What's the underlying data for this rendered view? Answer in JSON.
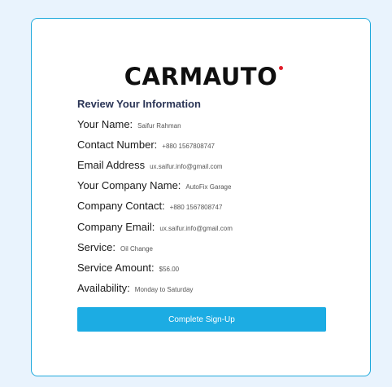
{
  "brand": {
    "name": "CARMAUTO",
    "accent_dot_color": "#e11d2a"
  },
  "review": {
    "title": "Review Your Information",
    "fields": [
      {
        "label": "Your Name:",
        "value": "Saifur Rahman"
      },
      {
        "label": "Contact Number:",
        "value": "+880 1567808747"
      },
      {
        "label": "Email Address",
        "value": "ux.saifur.info@gmail.com"
      },
      {
        "label": "Your Company Name:",
        "value": "AutoFix Garage"
      },
      {
        "label": "Company Contact:",
        "value": "+880 1567808747"
      },
      {
        "label": "Company Email:",
        "value": "ux.saifur.info@gmail.com"
      },
      {
        "label": "Service:",
        "value": "Oil Change"
      },
      {
        "label": "Service Amount:",
        "value": "$56.00"
      },
      {
        "label": "Availability:",
        "value": "Monday to Saturday"
      }
    ]
  },
  "actions": {
    "submit_label": "Complete Sign-Up"
  },
  "colors": {
    "page_background": "#e9f3fd",
    "card_border": "#1fa9dc",
    "button_background": "#1cace3"
  }
}
